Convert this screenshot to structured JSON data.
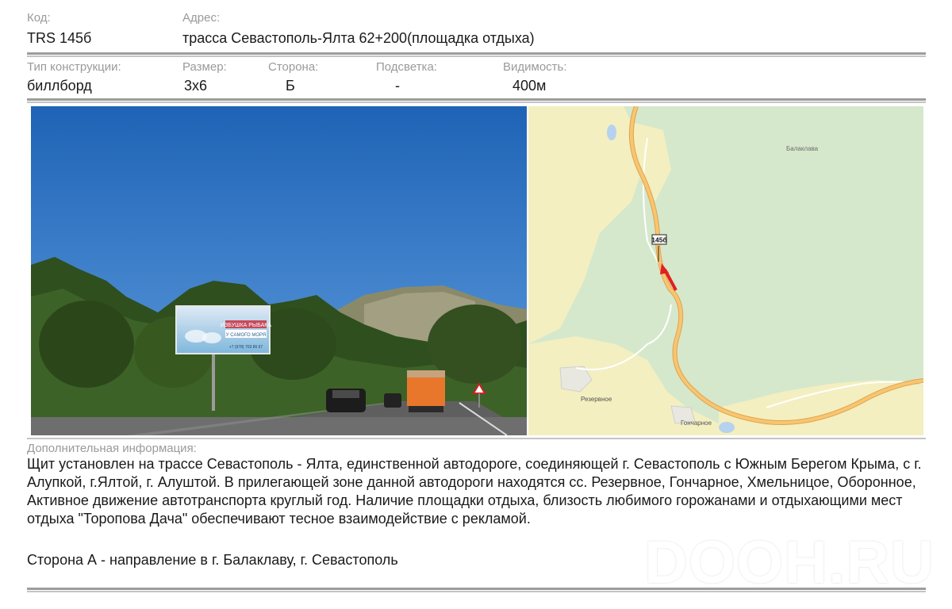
{
  "header": {
    "code_label": "Код:",
    "code_value": "TRS 145б",
    "address_label": "Адрес:",
    "address_value": "трасса Севастополь-Ялта 62+200(площадка отдыха)"
  },
  "specs": {
    "type_label": "Тип конструкции:",
    "type_value": "биллборд",
    "size_label": "Размер:",
    "size_value": "3х6",
    "side_label": "Сторона:",
    "side_value": "Б",
    "light_label": "Подсветка:",
    "light_value": "-",
    "visibility_label": "Видимость:",
    "visibility_value": "400м"
  },
  "photo": {
    "billboard": {
      "line1": "ИЗБУШКА РЫБАКА",
      "line2": "У САМОГО МОРЯ",
      "phone": "+7 (978) 703 86 67"
    }
  },
  "map": {
    "places": [
      "Балаклава",
      "Резервное",
      "Гончарное"
    ],
    "marker_label": "145б",
    "road_colors": {
      "main": "#f6b55a",
      "arrow": "#e32020",
      "land": "#d5e8cc",
      "field": "#f3efc0",
      "water": "#b6d2ee"
    }
  },
  "additional": {
    "label": "Дополнительная информация:",
    "text": "Щит установлен на трассе Севастополь - Ялта, единственной автодороге, соединяющей г. Севастополь с Южным Берегом Крыма, с г. Алупкой, г.Ялтой, г. Алуштой. В прилегающей зоне данной автодороги находятся сс. Резервное, Гончарное, Хмельницое, Оборонное,   Активное движение автотранспорта круглый год. Наличие площадки отдыха, близость любимого горожанами и отдыхающими  мест отдыха \"Торопова Дача\" обеспечивают тесное взаимодействие с рекламой.",
    "side_a": "Сторона А - направление в г. Балаклаву, г. Севастополь"
  },
  "watermark": "DOOH.RU"
}
